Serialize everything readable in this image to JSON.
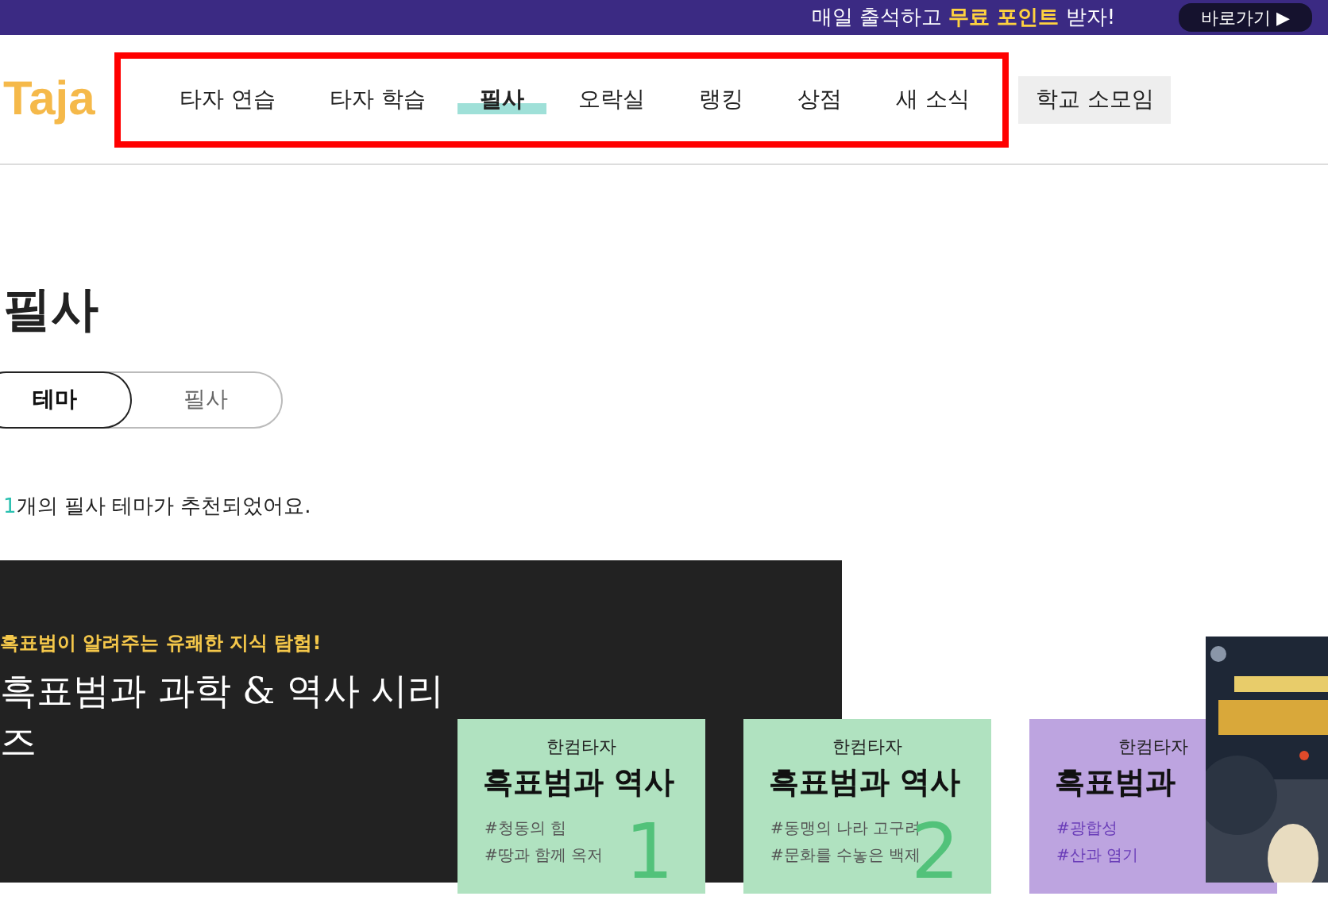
{
  "banner": {
    "text": "매일 출석하고 **무료 포인트** 받자!",
    "button": "바로가기 ▶"
  },
  "header": {
    "logo": "Taja",
    "nav": [
      {
        "label": "타자 연습",
        "selected": false
      },
      {
        "label": "타자 학습",
        "selected": false
      },
      {
        "label": "필사",
        "selected": true
      },
      {
        "label": "오락실",
        "selected": false
      },
      {
        "label": "랭킹",
        "selected": false
      },
      {
        "label": "상점",
        "selected": false
      },
      {
        "label": "새 소식",
        "selected": false
      }
    ],
    "side_link": "학교 소모임"
  },
  "page": {
    "title": "필사",
    "toggle": [
      {
        "label": "테마",
        "selected": true
      },
      {
        "label": "필사",
        "selected": false
      }
    ],
    "count": "1",
    "count_text": "개의 필사 테마가 추천되었어요."
  },
  "feature": {
    "subtitle": "흑표범이 알려주는 유쾌한 지식 탐험!",
    "title": "흑표범과 과학 & 역사 시리즈",
    "books": [
      {
        "publisher": "한컴타자",
        "title": "흑표범과 역사",
        "tags": [
          "#청동의 힘",
          "#땅과 함께 옥저"
        ],
        "number": "1",
        "color": "#b0e2c0"
      },
      {
        "publisher": "한컴타자",
        "title": "흑표범과 역사",
        "tags": [
          "#동맹의 나라 고구려",
          "#문화를 수놓은 백제"
        ],
        "number": "2",
        "color": "#b0e2c0"
      },
      {
        "publisher": "한컴타자",
        "title": "흑표범과",
        "tags": [
          "#광합성",
          "#산과 염기"
        ],
        "color": "#bda4e0"
      }
    ]
  }
}
